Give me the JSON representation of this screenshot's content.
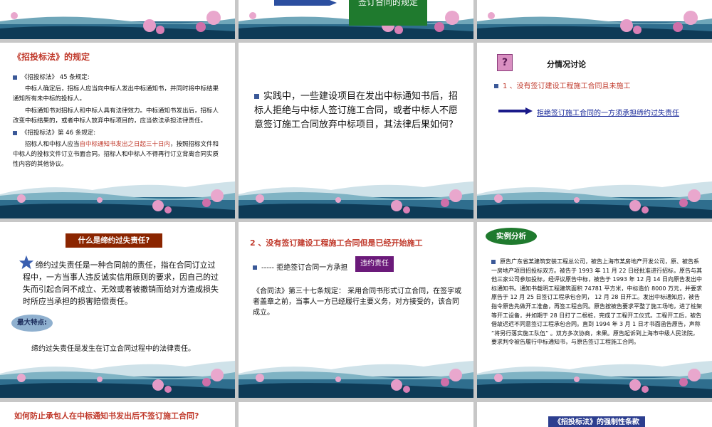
{
  "slides": {
    "s2": {
      "box_text": "签订合同的规定"
    },
    "s4": {
      "title": "《招投标法》的规定",
      "b1_head": "《招投标法》 45 条规定:",
      "b1_p1": "中标人确定后，招标人应当向中标人发出中标通知书，并同时将中标结果通知所有未中标的投标人。",
      "b1_p2": "中标通知书对招标人和中标人具有法律效力。中标通知书发出后，招标人改变中标结果的，或者中标人放弃中标项目的，应当依法承担法律责任。",
      "b2_head": "《招投标法》第 46 条规定:",
      "b2_pre": "招标人和中标人应当",
      "b2_red": "自中标通知书发出之日起三十日内",
      "b2_post": "，按照招标文件和中标人的投标文件订立书面合同。招标人和中标人不得再行订立背离合同实质性内容的其他协议。"
    },
    "s5": {
      "text": "实践中，一些建设项目在发出中标通知书后，招标人拒绝与中标人签订施工合同，或者中标人不愿意签订施工合同放弃中标项目，其法律后果如何?"
    },
    "s6": {
      "q": "?",
      "title": "分情况讨论",
      "item": "1 、没有签订建设工程施工合同且未施工",
      "link": "拒绝签订施工合同的一方须承担缔约过失责任"
    },
    "s7": {
      "title": "什么是缔约过失责任?",
      "text": "缔约过失责任是一种合同前的责任，指在合同订立过程中，一方当事人违反诚实信用原则的要求，因自己的过失而引起合同不成立、无效或者被撤销而给对方造成损失时所应当承担的损害赔偿责任。",
      "feature_label": "最大特点:",
      "feature_text": "缔约过失责任是发生在订立合同过程中的法律责任。"
    },
    "s8": {
      "title": "2 、没有签订建设工程施工合同但是已经开始施工",
      "item": "----- 拒绝签订合同一方承担",
      "tag": "违约责任",
      "law": "《合同法》第三十七条规定： 采用合同书形式订立合同，在签字或者盖章之前，当事人一方已经履行主要义务，对方接受的，该合同成立。"
    },
    "s9": {
      "label": "实例分析",
      "text": "原告广东省某建筑安装工程总公司，被告上海市某房地产开发公司，原、被告系一房地产项目招投标双方。被告于 1993 年 11 月 22 日经批准进行招标，原告与其他三家公司参加投标，经评议原告中标，被告于 1993 年 12 月 14 日向原告发出中标通知书。通知书载明工程建筑面积 74781 平方米，中标造价 8000 万元，并要求原告于 12 月 25 日签订工程承包合同， 12 月 28 日开工。发出中标通知后，被告指令原告先做开工准备，再签工程合同。原告按被告要求平整了施工场地，进了桩架等开工设备，并如期于 28 日打了二根桩，完成了工程开工仪式。工程开工后，被告借故迟迟不同意签订工程承包合同。直到 1994 年 3 月 1 日才书面函告原告，声称 “将另行落实施工队伍” 。双方多次协商，未果。原告起诉到上海市中级人民法院，要求判令被告履行中标通知书，与原告签订工程施工合同。"
    },
    "s10": {
      "title": "如何防止承包人在中标通知书发出后不签订施工合同?"
    },
    "s12": {
      "title": "《招投标法》的强制性条款"
    }
  },
  "colors": {
    "red": "#c0392b",
    "navy": "#2c3e8f",
    "green": "#1f7a2e",
    "brown": "#8b2500",
    "purple": "#6b1a7a"
  }
}
